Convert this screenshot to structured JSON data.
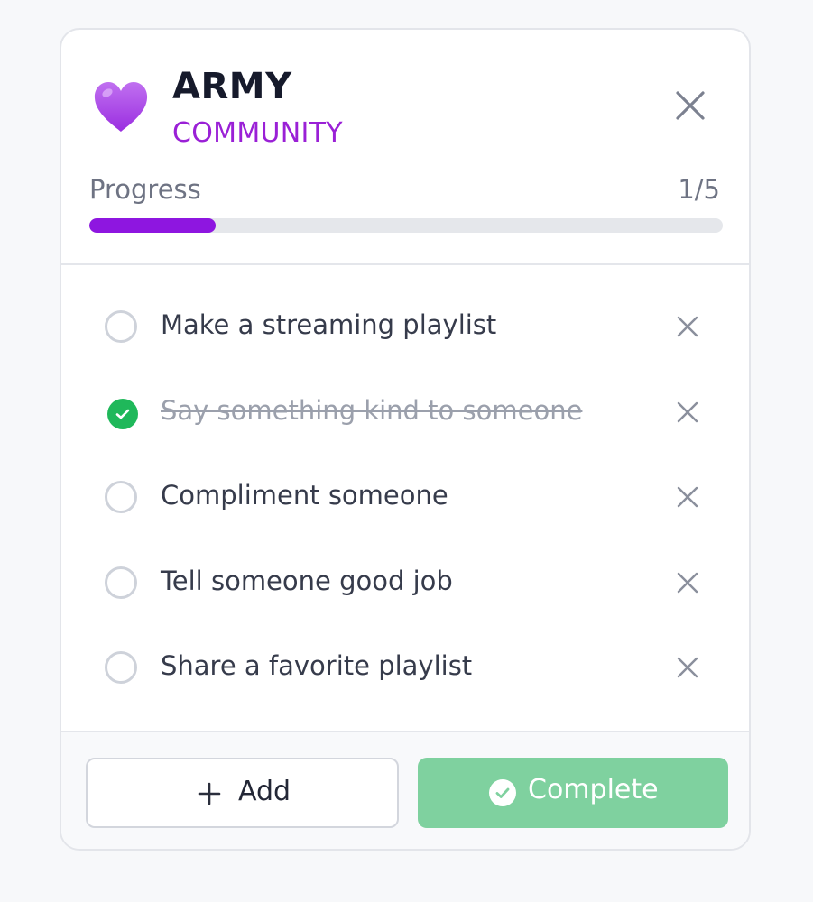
{
  "header": {
    "icon": "purple-heart-emoji",
    "title": "ARMY",
    "subtitle": "COMMUNITY",
    "close_icon": "close-icon"
  },
  "progress": {
    "label": "Progress",
    "count_text": "1/5",
    "completed": 1,
    "total": 5,
    "fraction": 0.2
  },
  "tasks": [
    {
      "label": "Make a streaming playlist",
      "done": false
    },
    {
      "label": "Say something kind to someone",
      "done": true
    },
    {
      "label": "Compliment someone",
      "done": false
    },
    {
      "label": "Tell someone good job",
      "done": false
    },
    {
      "label": "Share a favorite playlist",
      "done": false
    }
  ],
  "footer": {
    "add_label": "Add",
    "complete_label": "Complete"
  },
  "colors": {
    "accent_purple": "#8e16e0",
    "subtitle_purple": "#9a20d6",
    "success_green": "#1fb85a",
    "complete_button": "#7fd19f"
  }
}
